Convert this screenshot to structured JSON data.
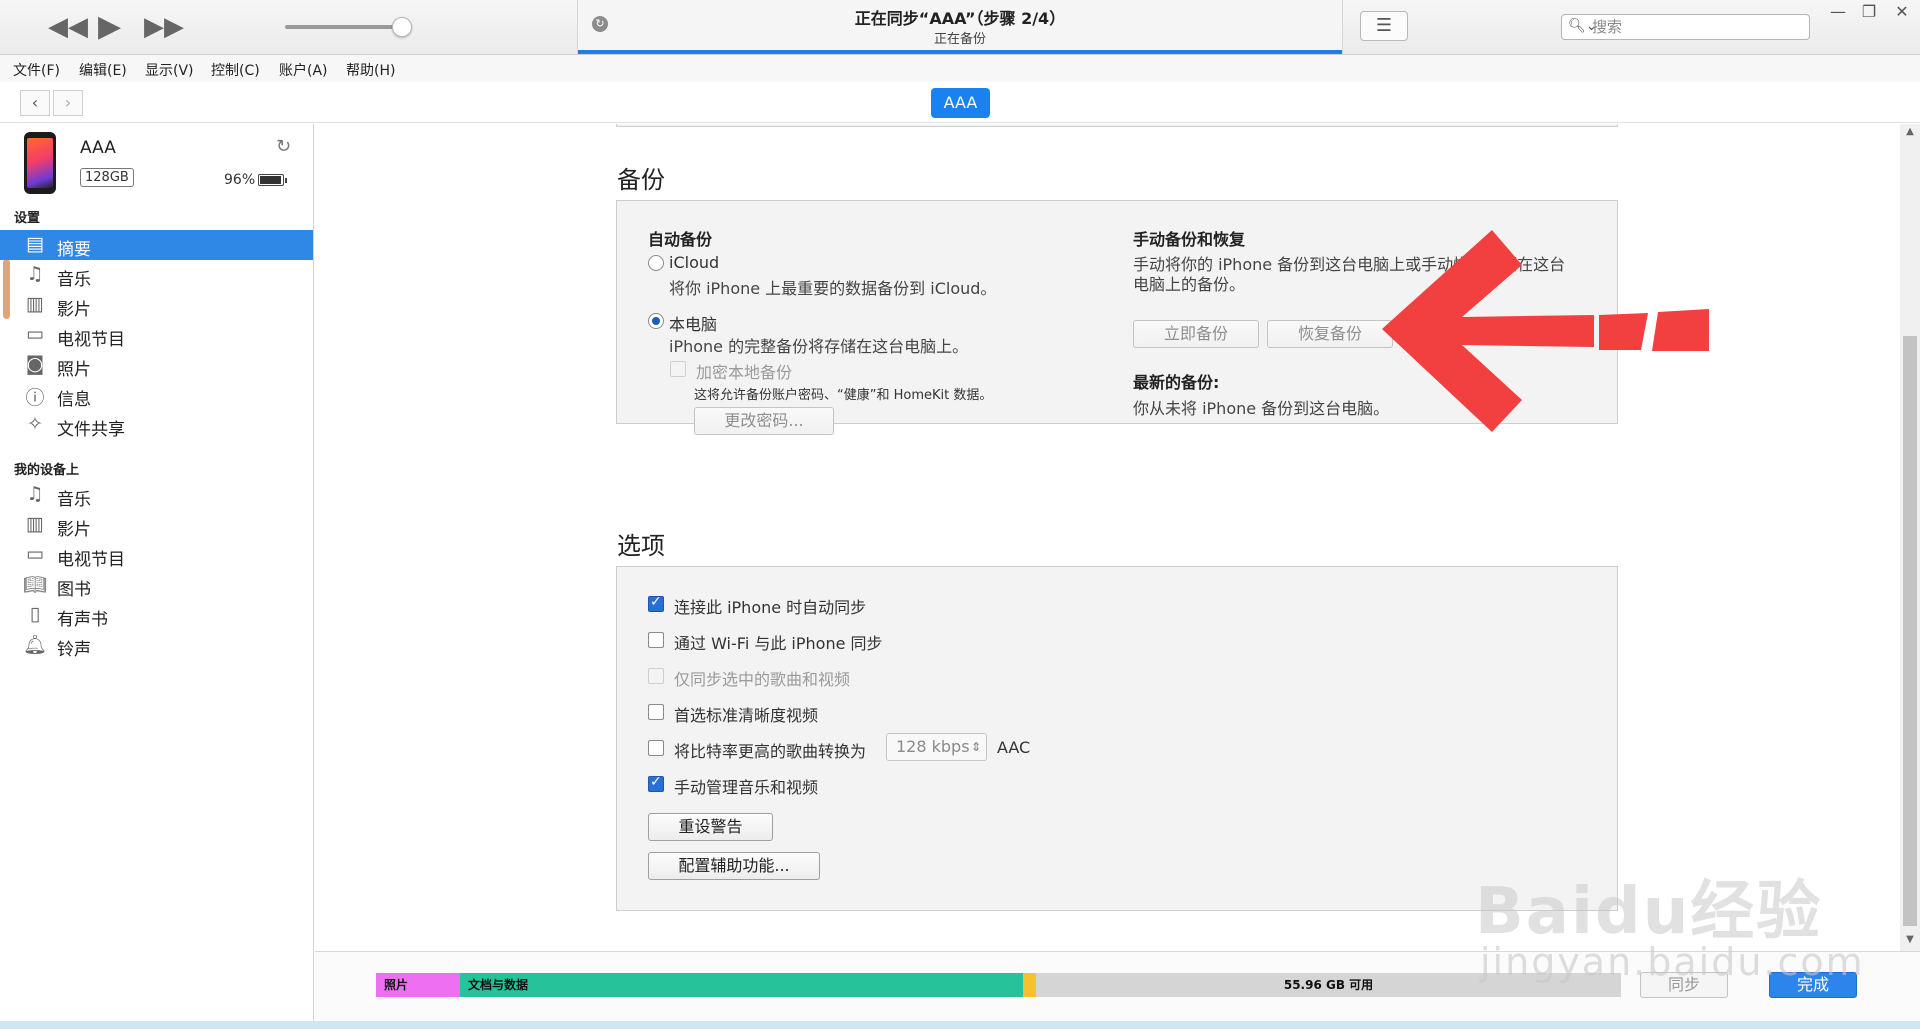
{
  "colors": {
    "accent": "#2f88e6",
    "arrow": "#f23f3f",
    "photos_seg": "#ee6ff1",
    "docs_seg": "#26c39a",
    "other_seg": "#f6c12d"
  },
  "toolbar": {
    "rewind_icon": "rewind-icon",
    "play_icon": "play-icon",
    "forward_icon": "fast-forward-icon",
    "status_title": "正在同步“AAA”（步骤 2/4）",
    "status_sub": "正在备份",
    "search_placeholder": "搜索"
  },
  "menu": [
    "文件(F)",
    "编辑(E)",
    "显示(V)",
    "控制(C)",
    "账户(A)",
    "帮助(H)"
  ],
  "nav": {
    "device_pill": "AAA"
  },
  "device": {
    "name": "AAA",
    "capacity": "128GB",
    "battery": "96%"
  },
  "sidebar": {
    "settings_header": "设置",
    "settings_items": [
      {
        "label": "摘要",
        "icon": "summary-icon",
        "active": true
      },
      {
        "label": "音乐",
        "icon": "music-note-icon"
      },
      {
        "label": "影片",
        "icon": "film-icon"
      },
      {
        "label": "电视节目",
        "icon": "tv-icon"
      },
      {
        "label": "照片",
        "icon": "camera-icon"
      },
      {
        "label": "信息",
        "icon": "info-icon"
      },
      {
        "label": "文件共享",
        "icon": "app-store-icon"
      }
    ],
    "device_header": "我的设备上",
    "device_items": [
      {
        "label": "音乐",
        "icon": "music-note-icon"
      },
      {
        "label": "影片",
        "icon": "film-icon"
      },
      {
        "label": "电视节目",
        "icon": "tv-icon"
      },
      {
        "label": "图书",
        "icon": "book-icon"
      },
      {
        "label": "有声书",
        "icon": "audiobook-icon"
      },
      {
        "label": "铃声",
        "icon": "bell-icon"
      }
    ]
  },
  "backup": {
    "heading": "备份",
    "auto_title": "自动备份",
    "icloud_label": "iCloud",
    "icloud_desc": "将你 iPhone 上最重要的数据备份到 iCloud。",
    "computer_label": "本电脑",
    "computer_desc": "iPhone 的完整备份将存储在这台电脑上。",
    "encrypt_label": "加密本地备份",
    "encrypt_desc": "这将允许备份账户密码、“健康”和 HomeKit 数据。",
    "change_password": "更改密码...",
    "manual_title": "手动备份和恢复",
    "manual_desc_1": "手动将你的 iPhone 备份到这台电脑上或手动恢复存储在这台",
    "manual_desc_2": "电脑上的备份。",
    "backup_now": "立即备份",
    "restore_backup": "恢复备份",
    "latest_title": "最新的备份:",
    "latest_desc": "你从未将 iPhone 备份到这台电脑。"
  },
  "options": {
    "heading": "选项",
    "items": [
      {
        "label": "连接此 iPhone 时自动同步",
        "checked": true,
        "disabled": false
      },
      {
        "label": "通过 Wi-Fi 与此 iPhone 同步",
        "checked": false,
        "disabled": false
      },
      {
        "label": "仅同步选中的歌曲和视频",
        "checked": false,
        "disabled": true
      },
      {
        "label": "首选标准清晰度视频",
        "checked": false,
        "disabled": false
      },
      {
        "label": "将比特率更高的歌曲转换为",
        "checked": false,
        "disabled": false
      },
      {
        "label": "手动管理音乐和视频",
        "checked": true,
        "disabled": false
      }
    ],
    "bitrate_value": "128 kbps",
    "bitrate_format": "AAC",
    "reset_warnings": "重设警告",
    "accessibility": "配置辅助功能..."
  },
  "storage": {
    "photos_label": "照片",
    "docs_label": "文档与数据",
    "free_label": "55.96 GB 可用",
    "sync_button": "同步",
    "done_button": "完成"
  },
  "watermark": {
    "logo": "Baidu经验",
    "url": "jingyan.baidu.com"
  }
}
